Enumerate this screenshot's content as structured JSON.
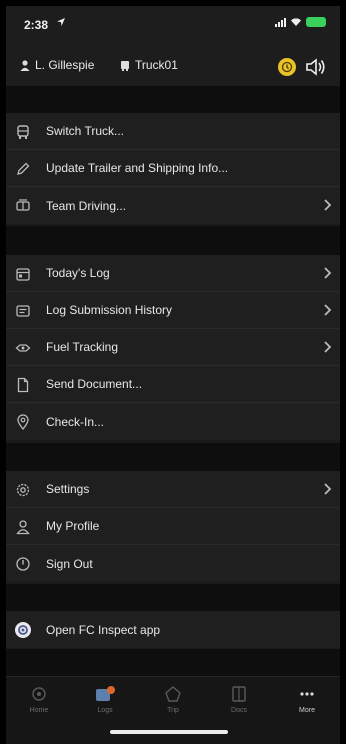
{
  "status_bar": {
    "time": "2:38"
  },
  "header": {
    "driver": "L. Gillespie",
    "truck": "Truck01"
  },
  "menu_groups": [
    {
      "items": [
        {
          "label": "Switch Truck...",
          "icon": "truck-icon",
          "chevron": false
        },
        {
          "label": "Update Trailer and Shipping Info...",
          "icon": "pencil-icon",
          "chevron": false
        },
        {
          "label": "Team Driving...",
          "icon": "team-icon",
          "chevron": true
        }
      ]
    },
    {
      "items": [
        {
          "label": "Today's Log",
          "icon": "calendar-icon",
          "chevron": true
        },
        {
          "label": "Log Submission History",
          "icon": "log-history-icon",
          "chevron": true
        },
        {
          "label": "Fuel Tracking",
          "icon": "fuel-icon",
          "chevron": true
        },
        {
          "label": "Send Document...",
          "icon": "document-icon",
          "chevron": false
        },
        {
          "label": "Check-In...",
          "icon": "location-pin-icon",
          "chevron": false
        }
      ]
    },
    {
      "items": [
        {
          "label": "Settings",
          "icon": "gear-icon",
          "chevron": true
        },
        {
          "label": "My Profile",
          "icon": "person-icon",
          "chevron": false
        },
        {
          "label": "Sign Out",
          "icon": "power-icon",
          "chevron": false
        }
      ]
    },
    {
      "items": [
        {
          "label": "Open FC Inspect app",
          "icon": "inspect-app-icon",
          "chevron": false
        }
      ]
    }
  ],
  "tabs": [
    {
      "label": "Home",
      "icon": "home-icon",
      "active": false
    },
    {
      "label": "Logs",
      "icon": "logs-icon",
      "active": false,
      "badge": true
    },
    {
      "label": "Trip",
      "icon": "trip-icon",
      "active": false
    },
    {
      "label": "Docs",
      "icon": "docs-icon",
      "active": false
    },
    {
      "label": "More",
      "icon": "more-icon",
      "active": true
    }
  ],
  "colors": {
    "accent_alert": "#e8c227",
    "battery": "#39d15b",
    "badge": "#e0672a"
  }
}
